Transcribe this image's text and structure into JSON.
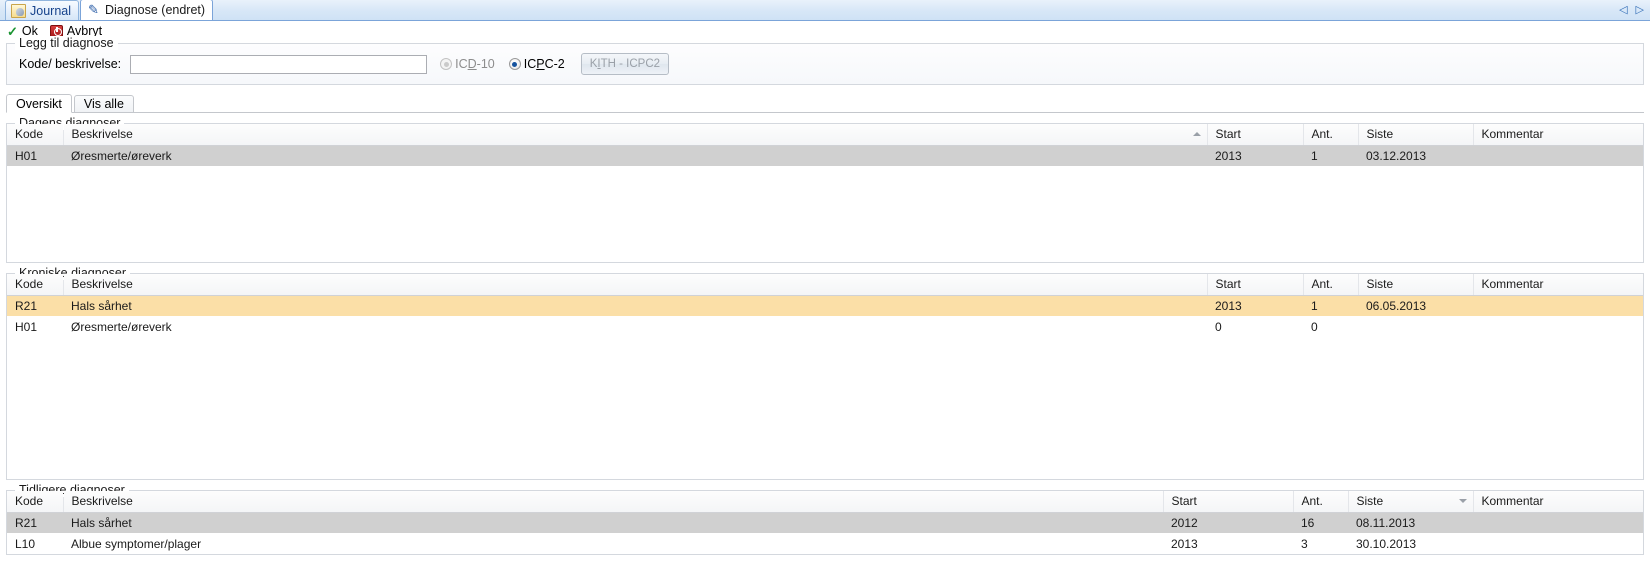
{
  "window": {
    "tabs": [
      {
        "label": "Journal",
        "icon": "journal-icon",
        "active": false
      },
      {
        "label": "Diagnose (endret)",
        "icon": "diagnosis-icon",
        "active": true
      }
    ],
    "scroll_left": "◁",
    "scroll_right": "▷"
  },
  "toolbar": {
    "ok_label": "Ok",
    "cancel_label": "Avbryt",
    "ok_icon": "checkmark-icon",
    "cancel_icon": "stop-icon"
  },
  "add_panel": {
    "legend": "Legg til diagnose",
    "code_label": "Kode/ beskrivelse:",
    "code_value": "",
    "code_placeholder": "",
    "radios": [
      {
        "id": "icd10",
        "label_before": "IC",
        "mnemonic": "D",
        "label_after": "-10",
        "selected": false,
        "disabled": true
      },
      {
        "id": "icpc2",
        "label_before": "IC",
        "mnemonic": "P",
        "label_after": "C-2",
        "selected": true,
        "disabled": false
      }
    ],
    "kith_button": {
      "label_before": "K",
      "mnemonic": "I",
      "label_after": "TH - ICPC2",
      "disabled": true
    }
  },
  "inner_tabs": [
    {
      "label": "Oversikt",
      "active": true
    },
    {
      "label": "Vis alle",
      "active": false
    }
  ],
  "columns": [
    "Kode",
    "Beskrivelse",
    "Start",
    "Ant.",
    "Siste",
    "Kommentar"
  ],
  "sections": [
    {
      "id": "dagens",
      "legend": "Dagens diagnoser",
      "sort": {
        "column": "Beskrivelse",
        "direction": "asc"
      },
      "rows": [
        {
          "kode": "H01",
          "beskrivelse": "Øresmerte/øreverk",
          "start": "2013",
          "ant": "1",
          "siste": "03.12.2013",
          "kommentar": "",
          "state": "selected"
        }
      ]
    },
    {
      "id": "kroniske",
      "legend": "Kroniske diagnoser",
      "sort": {
        "column": "",
        "direction": ""
      },
      "rows": [
        {
          "kode": "R21",
          "beskrivelse": "Hals sårhet",
          "start": "2013",
          "ant": "1",
          "siste": "06.05.2013",
          "kommentar": "",
          "state": "highlight"
        },
        {
          "kode": "H01",
          "beskrivelse": "Øresmerte/øreverk",
          "start": "0",
          "ant": "0",
          "siste": "",
          "kommentar": "",
          "state": ""
        }
      ]
    },
    {
      "id": "tidligere",
      "legend": "Tidligere diagnoser",
      "sort": {
        "column": "Siste",
        "direction": "desc"
      },
      "rows": [
        {
          "kode": "R21",
          "beskrivelse": "Hals sårhet",
          "start": "2012",
          "ant": "16",
          "siste": "08.11.2013",
          "kommentar": "",
          "state": "selected"
        },
        {
          "kode": "L10",
          "beskrivelse": "Albue symptomer/plager",
          "start": "2013",
          "ant": "3",
          "siste": "30.10.2013",
          "kommentar": "",
          "state": ""
        }
      ]
    }
  ],
  "colors": {
    "selection_grey": "#d0d0d0",
    "highlight_amber": "#fbdfa7",
    "tab_blue": "#15428b",
    "ok_green": "#1a9431",
    "cancel_red": "#a51616"
  }
}
